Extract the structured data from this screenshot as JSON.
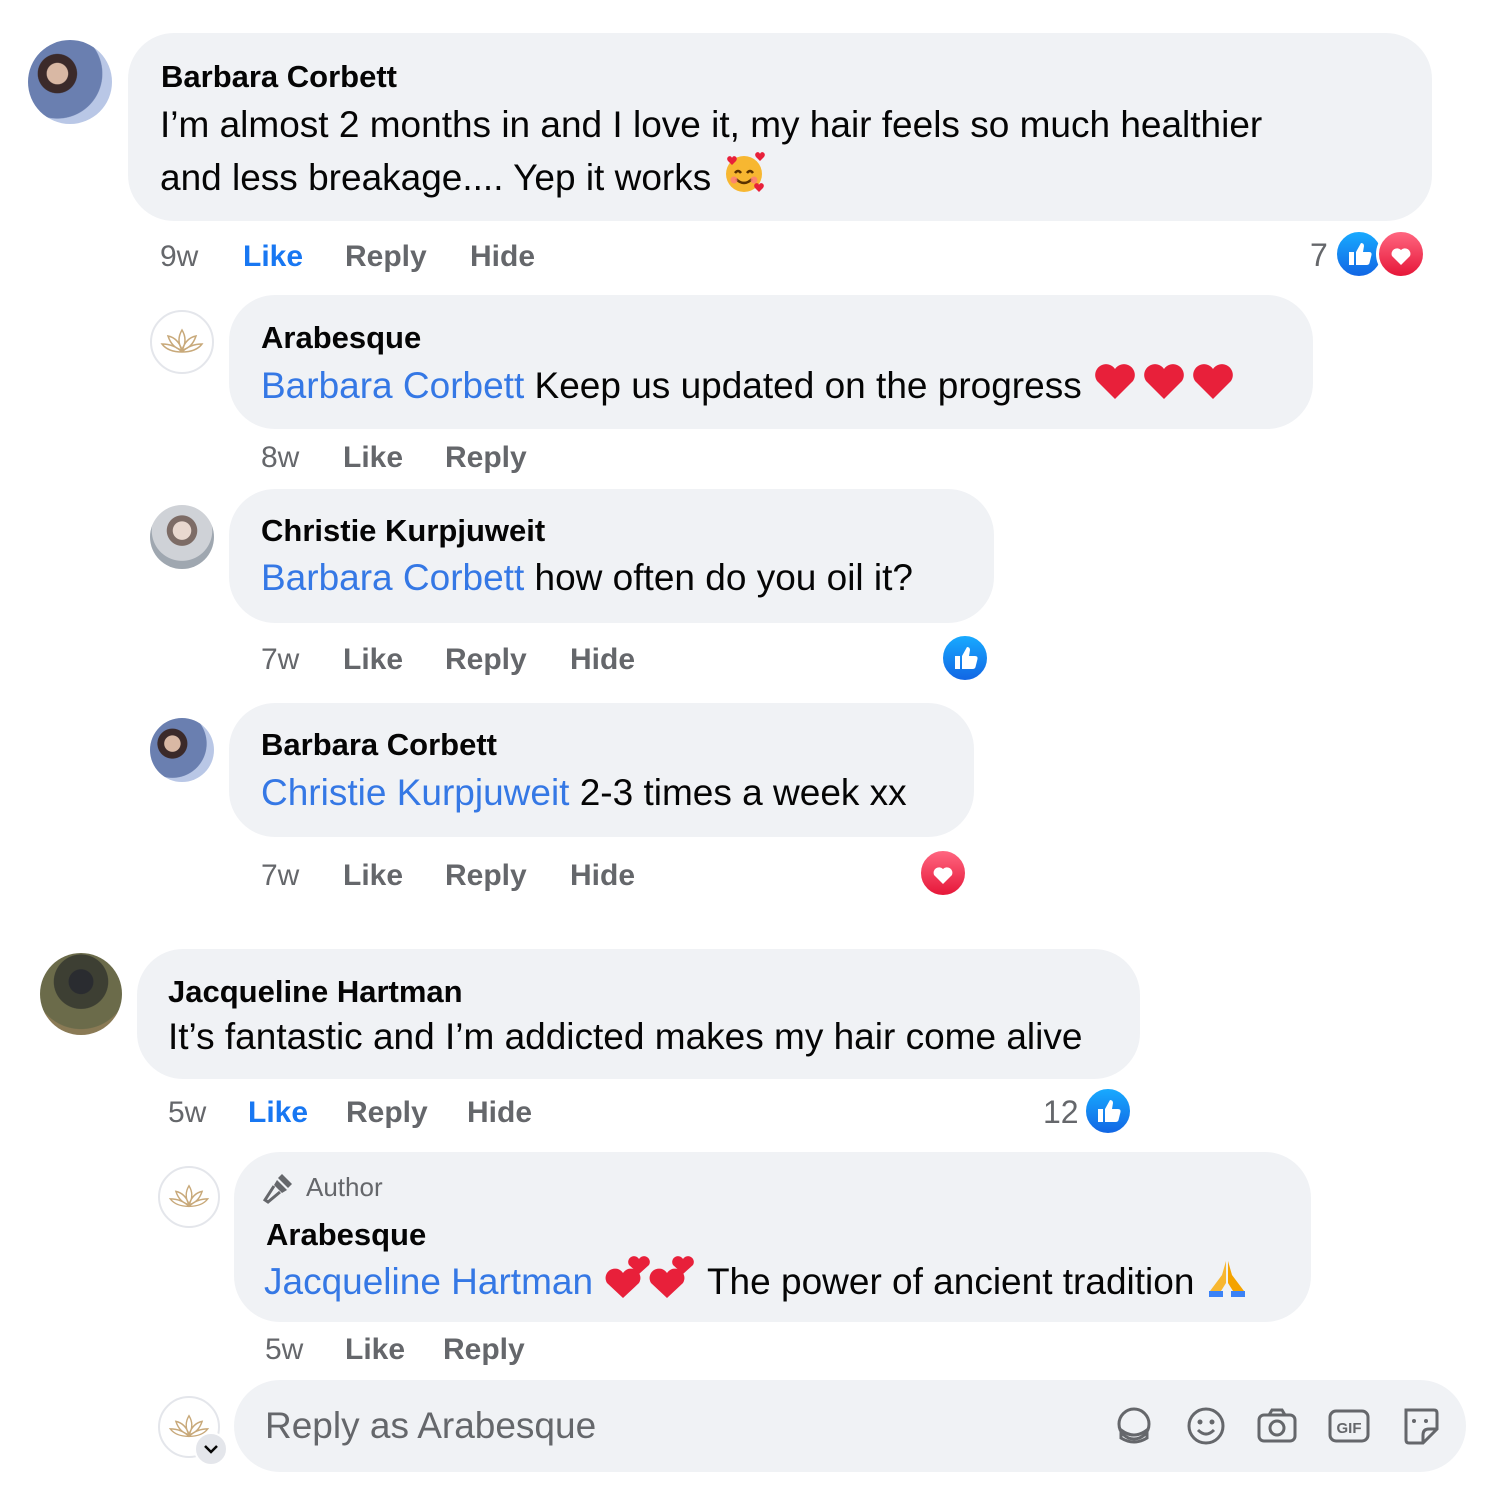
{
  "comments": [
    {
      "author": "Barbara Corbett",
      "text_line1": "I’m almost 2 months in and I love it, my hair feels so much healthier",
      "text_line2": "and less breakage.... Yep it works",
      "emoji": "smiling-face-with-hearts",
      "time": "9w",
      "like": "Like",
      "reply": "Reply",
      "hide": "Hide",
      "reaction_count": "7",
      "reactions": [
        "like",
        "love"
      ]
    },
    {
      "author": "Arabesque",
      "mention": "Barbara Corbett",
      "text": " Keep us updated on the progress",
      "emoji": "three-red-hearts",
      "time": "8w",
      "like": "Like",
      "reply": "Reply"
    },
    {
      "author": "Christie Kurpjuweit",
      "mention": "Barbara Corbett",
      "text": " how often do you oil it?",
      "time": "7w",
      "like": "Like",
      "reply": "Reply",
      "hide": "Hide",
      "reactions": [
        "like"
      ]
    },
    {
      "author": "Barbara Corbett",
      "mention": "Christie Kurpjuweit",
      "text": " 2-3 times a week xx",
      "time": "7w",
      "like": "Like",
      "reply": "Reply",
      "hide": "Hide",
      "reactions": [
        "love"
      ]
    },
    {
      "author": "Jacqueline Hartman",
      "text": "It’s fantastic and I’m addicted makes my hair come alive",
      "time": "5w",
      "like": "Like",
      "reply": "Reply",
      "hide": "Hide",
      "reaction_count": "12",
      "reactions": [
        "like"
      ]
    },
    {
      "badge": "Author",
      "author": "Arabesque",
      "mention": "Jacqueline Hartman",
      "text": " The power of ancient tradition",
      "emoji_before": "two-hearts",
      "emoji_after": "folded-hands",
      "time": "5w",
      "like": "Like",
      "reply": "Reply"
    }
  ],
  "reply_box": {
    "placeholder": "Reply as Arabesque",
    "tools": [
      "avatar-sticker-icon",
      "emoji-icon",
      "camera-icon",
      "gif-icon",
      "sticker-icon"
    ]
  },
  "colors": {
    "bubble": "#f0f2f5",
    "mention": "#3578e5",
    "like_active": "#1877f2",
    "meta": "#65676b"
  }
}
